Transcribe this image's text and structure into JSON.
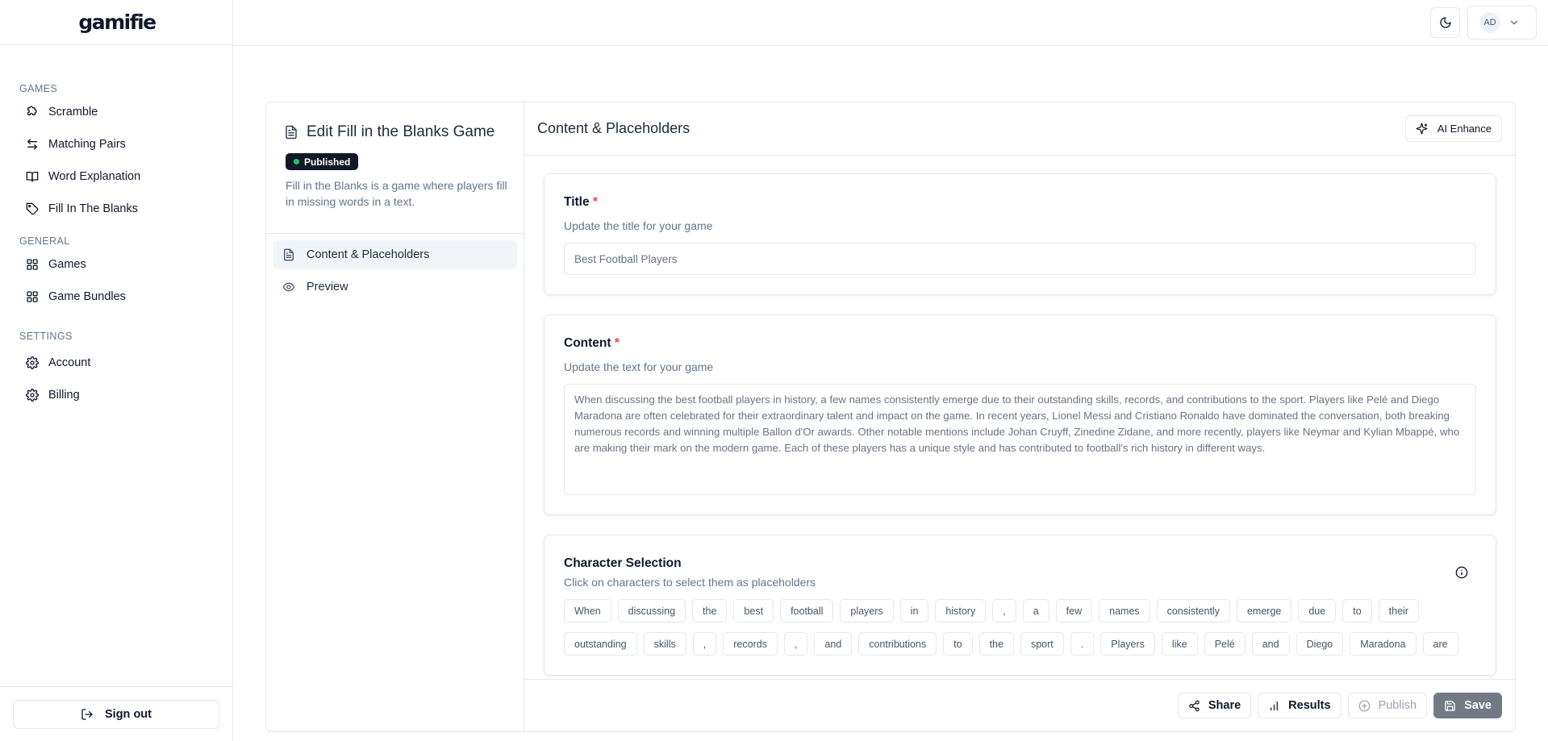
{
  "brand": {
    "logo": "gamifie"
  },
  "sidebar": {
    "sections": [
      {
        "heading": "GAMES",
        "items": [
          {
            "label": "Scramble",
            "icon": "puzzle-icon"
          },
          {
            "label": "Matching Pairs",
            "icon": "arrows-swap-icon"
          },
          {
            "label": "Word Explanation",
            "icon": "book-open-icon"
          },
          {
            "label": "Fill In The Blanks",
            "icon": "tag-icon"
          }
        ]
      },
      {
        "heading": "GENERAL",
        "items": [
          {
            "label": "Games",
            "icon": "grid-icon"
          },
          {
            "label": "Game Bundles",
            "icon": "grid-icon"
          }
        ]
      },
      {
        "heading": "SETTINGS",
        "items": [
          {
            "label": "Account",
            "icon": "gear-icon"
          },
          {
            "label": "Billing",
            "icon": "gear-icon"
          }
        ]
      }
    ],
    "sign_out": "Sign out"
  },
  "header": {
    "user_initials": "AD"
  },
  "editor": {
    "title": "Edit Fill in the Blanks Game",
    "status": "Published",
    "description": "Fill in the Blanks is a game where players fill in missing words in a text.",
    "nav": [
      {
        "label": "Content & Placeholders",
        "icon": "document-icon",
        "active": true
      },
      {
        "label": "Preview",
        "icon": "eye-icon",
        "active": false
      }
    ]
  },
  "content_panel": {
    "heading": "Content & Placeholders",
    "ai_button": "AI Enhance",
    "title_field": {
      "label": "Title",
      "required": "*",
      "help": "Update the title for your game",
      "value": "Best Football Players"
    },
    "content_field": {
      "label": "Content",
      "required": "*",
      "help": "Update the text for your game",
      "value": "When discussing the best football players in history, a few names consistently emerge due to their outstanding skills, records, and contributions to the sport. Players like Pelé and Diego Maradona are often celebrated for their extraordinary talent and impact on the game. In recent years, Lionel Messi and Cristiano Ronaldo have dominated the conversation, both breaking numerous records and winning multiple Ballon d'Or awards. Other notable mentions include Johan Cruyff, Zinedine Zidane, and more recently, players like Neymar and Kylian Mbappé, who are making their mark on the modern game. Each of these players has a unique style and has contributed to football's rich history in different ways."
    },
    "character_selection": {
      "label": "Character Selection",
      "help": "Click on characters to select them as placeholders",
      "tokens": [
        "When",
        "discussing",
        "the",
        "best",
        "football",
        "players",
        "in",
        "history",
        ",",
        "a",
        "few",
        "names",
        "consistently",
        "emerge",
        "due",
        "to",
        "their",
        "outstanding",
        "skills",
        ",",
        "records",
        ",",
        "and",
        "contributions",
        "to",
        "the",
        "sport",
        ".",
        "Players",
        "like",
        "Pelé",
        "and",
        "Diego",
        "Maradona",
        "are"
      ]
    }
  },
  "actions": {
    "share": "Share",
    "results": "Results",
    "publish": "Publish",
    "save": "Save"
  },
  "colors": {
    "badge_bg": "#111827",
    "status_dot": "#22c55e",
    "required": "#ef4444",
    "save_bg": "#737a86"
  }
}
